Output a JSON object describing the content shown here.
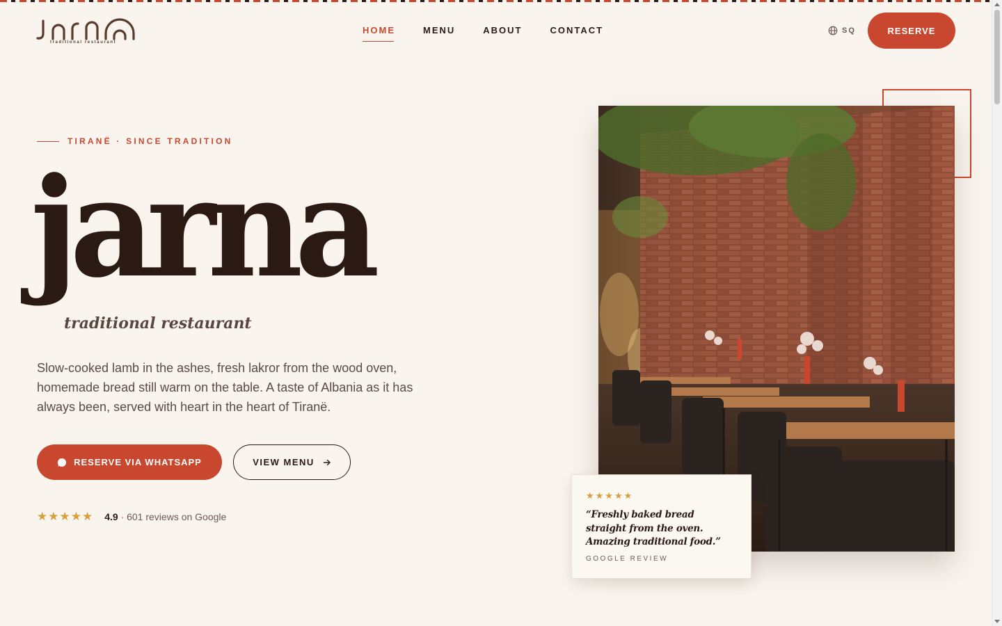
{
  "brand": {
    "logo_text": "Jarna",
    "logo_tagline": "traditional restaurant"
  },
  "nav": {
    "items": [
      {
        "label": "HOME",
        "active": true
      },
      {
        "label": "MENU",
        "active": false
      },
      {
        "label": "ABOUT",
        "active": false
      },
      {
        "label": "CONTACT",
        "active": false
      }
    ]
  },
  "header": {
    "language": "SQ",
    "reserve_label": "RESERVE"
  },
  "hero": {
    "eyebrow": "TIRANË · SINCE TRADITION",
    "title": "jarna",
    "subtitle": "traditional restaurant",
    "description": "Slow-cooked lamb in the ashes, fresh lakror from the wood oven, homemade bread still warm on the table. A taste of Albania as it has always been, served with heart in the heart of Tiranë.",
    "primary_button": "RESERVE VIA WHATSAPP",
    "secondary_button": "VIEW MENU",
    "rating": {
      "stars": "★★★★★",
      "score": "4.9",
      "text": "· 601 reviews on Google"
    }
  },
  "review_card": {
    "stars": "★★★★★",
    "quote": "“Freshly baked bread straight from the oven. Amazing traditional food.”",
    "source": "GOOGLE REVIEW"
  },
  "colors": {
    "accent": "#c9472e",
    "dark": "#2b1914",
    "background": "#f9f5ee",
    "star": "#d6a03a"
  },
  "icons": {
    "language": "globe-icon",
    "whatsapp": "chat-bubble-icon",
    "menu_arrow": "arrow-right-icon"
  }
}
